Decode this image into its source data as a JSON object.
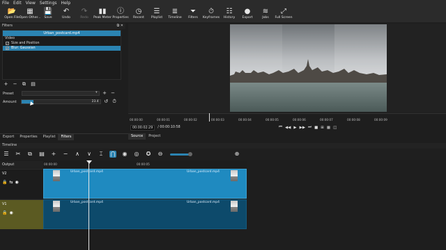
{
  "menu": [
    "File",
    "Edit",
    "View",
    "Settings",
    "Help"
  ],
  "toolbar": [
    {
      "label": "Open File",
      "icon": "folder-open-icon",
      "glyph": "📂",
      "dim": false
    },
    {
      "label": "Open Other...",
      "icon": "open-other-icon",
      "glyph": "▦",
      "dim": false
    },
    {
      "label": "Save",
      "icon": "save-icon",
      "glyph": "💾",
      "dim": false
    },
    {
      "label": "Undo",
      "icon": "undo-icon",
      "glyph": "↶",
      "dim": false
    },
    {
      "label": "Redo",
      "icon": "redo-icon",
      "glyph": "↷",
      "dim": true
    },
    {
      "label": "Peak Meter",
      "icon": "peak-meter-icon",
      "glyph": "▮▮",
      "dim": false
    },
    {
      "label": "Properties",
      "icon": "properties-icon",
      "glyph": "ⓘ",
      "dim": false
    },
    {
      "label": "Recent",
      "icon": "recent-icon",
      "glyph": "◷",
      "dim": false
    },
    {
      "label": "Playlist",
      "icon": "playlist-icon",
      "glyph": "☰",
      "dim": false
    },
    {
      "label": "Timeline",
      "icon": "timeline-icon",
      "glyph": "≣",
      "dim": false
    },
    {
      "label": "Filters",
      "icon": "filter-icon",
      "glyph": "⏷",
      "dim": false
    },
    {
      "label": "Keyframes",
      "icon": "keyframes-icon",
      "glyph": "⏱",
      "dim": false
    },
    {
      "label": "History",
      "icon": "history-icon",
      "glyph": "☷",
      "dim": false
    },
    {
      "label": "Export",
      "icon": "export-icon",
      "glyph": "●",
      "dim": false
    },
    {
      "label": "Jobs",
      "icon": "jobs-icon",
      "glyph": "≋",
      "dim": false
    },
    {
      "label": "Full Screen",
      "icon": "fullscreen-icon",
      "glyph": "⤢",
      "dim": false
    }
  ],
  "filters_panel": {
    "title": "Filters",
    "clip_name": "Urban_postcard.mp4",
    "section": "Video",
    "items": [
      {
        "label": "Size and Position",
        "checked": true,
        "selected": false
      },
      {
        "label": "Blur: Gaussian",
        "checked": true,
        "selected": true
      }
    ],
    "preset_label": "Preset",
    "preset_value": "",
    "amount_label": "Amount",
    "amount_value": "23.4",
    "amount_fraction": 0.15
  },
  "ruler_ticks": [
    "00:00:00",
    "00:00:01",
    "00:00:02",
    "00:00:03",
    "00:00:04",
    "00:00:05",
    "00:00:06",
    "00:00:07",
    "00:00:08",
    "00:00:09"
  ],
  "timecode": {
    "current": "00:00:02:29",
    "total": "/ 00:00:10:58"
  },
  "source_tabs": [
    "Source",
    "Project"
  ],
  "left_tabs": [
    "Export",
    "Properties",
    "Playlist",
    "Filters"
  ],
  "timeline": {
    "title": "Timeline",
    "output_label": "Output",
    "ruler": [
      "00:00:00",
      "00:00:05"
    ],
    "tracks": [
      {
        "name": "V2",
        "clips": [
          "Urban_postcard.mp4",
          "Urban_postcard.mp4"
        ]
      },
      {
        "name": "V1",
        "clips": [
          "Urban_postcard.mp4",
          "Urban_postcard.mp4"
        ]
      }
    ]
  },
  "colors": {
    "accent": "#2b84b2",
    "v1_header": "#5b5a22"
  }
}
